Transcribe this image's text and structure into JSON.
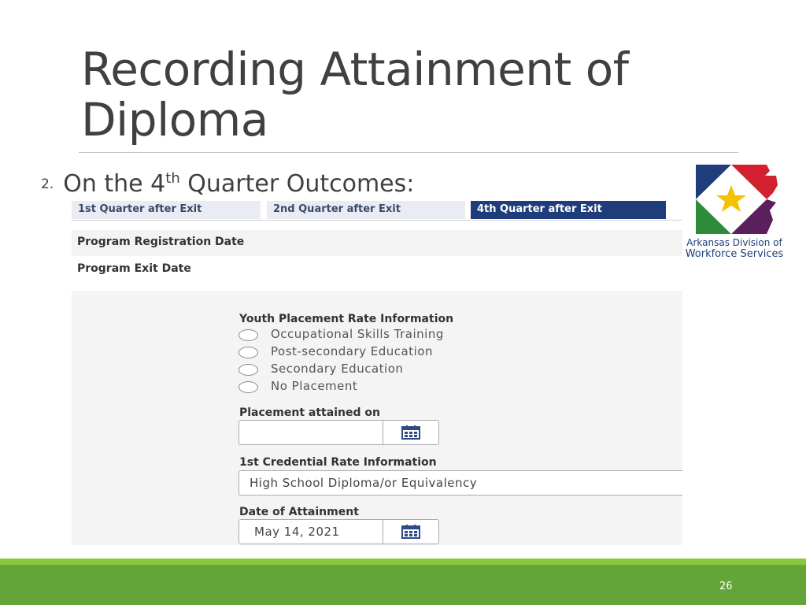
{
  "slide": {
    "title_line1": "Recording Attainment of",
    "title_line2": "Diploma",
    "step_number": "2.",
    "step_text_before": "On the 4",
    "step_text_sup": "th",
    "step_text_after": " Quarter Outcomes:",
    "page_number": "26"
  },
  "form": {
    "tabs": [
      {
        "label": "1st Quarter after Exit",
        "active": false
      },
      {
        "label": "2nd Quarter after Exit",
        "active": false
      },
      {
        "label": "4th Quarter after Exit",
        "active": true
      }
    ],
    "registration_label": "Program Registration Date",
    "exit_label": "Program Exit Date",
    "youth_placement": {
      "heading": "Youth Placement Rate Information",
      "options": [
        "Occupational Skills Training",
        "Post-secondary Education",
        "Secondary Education",
        "No Placement"
      ]
    },
    "placement_attained": {
      "label": "Placement attained on",
      "value": ""
    },
    "credential": {
      "label": "1st Credential Rate Information",
      "value": "High School Diploma/or Equivalency"
    },
    "attainment_date": {
      "label": "Date of Attainment",
      "value": "May 14, 2021"
    }
  },
  "logo": {
    "line1": "Arkansas Division of",
    "line2": "Workforce Services",
    "icon": "arkansas-state-star-icon"
  },
  "colors": {
    "active_tab": "#1f3d7a",
    "footer_band": "#63a538",
    "footer_band_light": "#8cc640",
    "title_text": "#404040"
  }
}
